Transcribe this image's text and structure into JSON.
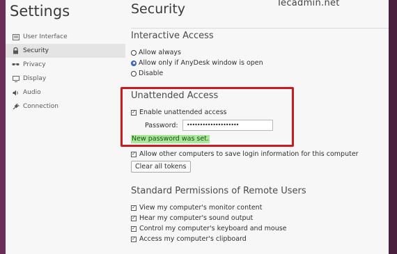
{
  "sidebar": {
    "title": "Settings",
    "items": [
      {
        "label": "User Interface",
        "icon": "monitor-icon",
        "active": false
      },
      {
        "label": "Security",
        "icon": "lock-icon",
        "active": true
      },
      {
        "label": "Privacy",
        "icon": "glasses-icon",
        "active": false
      },
      {
        "label": "Display",
        "icon": "display-icon",
        "active": false
      },
      {
        "label": "Audio",
        "icon": "speaker-icon",
        "active": false
      },
      {
        "label": "Connection",
        "icon": "plug-icon",
        "active": false
      }
    ]
  },
  "header": {
    "title": "Security",
    "watermark": "Tecadmin.net"
  },
  "interactive_access": {
    "title": "Interactive Access",
    "options": [
      {
        "label": "Allow always",
        "checked": false
      },
      {
        "label": "Allow only if AnyDesk window is open",
        "checked": true
      },
      {
        "label": "Disable",
        "checked": false
      }
    ]
  },
  "unattended_access": {
    "title": "Unattended Access",
    "enable_label": "Enable unattended access",
    "enable_checked": true,
    "password_label": "Password:",
    "password_value": "••••••••••••••••••••",
    "status_message": "New password was set.",
    "allow_save_label": "Allow other computers to save login information for this computer",
    "allow_save_checked": true,
    "clear_tokens_label": "Clear all tokens"
  },
  "standard_permissions": {
    "title": "Standard Permissions of Remote Users",
    "items": [
      {
        "label": "View my computer's monitor content",
        "checked": true
      },
      {
        "label": "Hear my computer's sound output",
        "checked": true
      },
      {
        "label": "Control my computer's keyboard and mouse",
        "checked": true
      },
      {
        "label": "Access my computer's clipboard",
        "checked": true
      }
    ]
  },
  "colors": {
    "highlight_border": "#c91d1d",
    "status_bg": "#a9e89b",
    "radio_selected": "#4a73c8"
  }
}
